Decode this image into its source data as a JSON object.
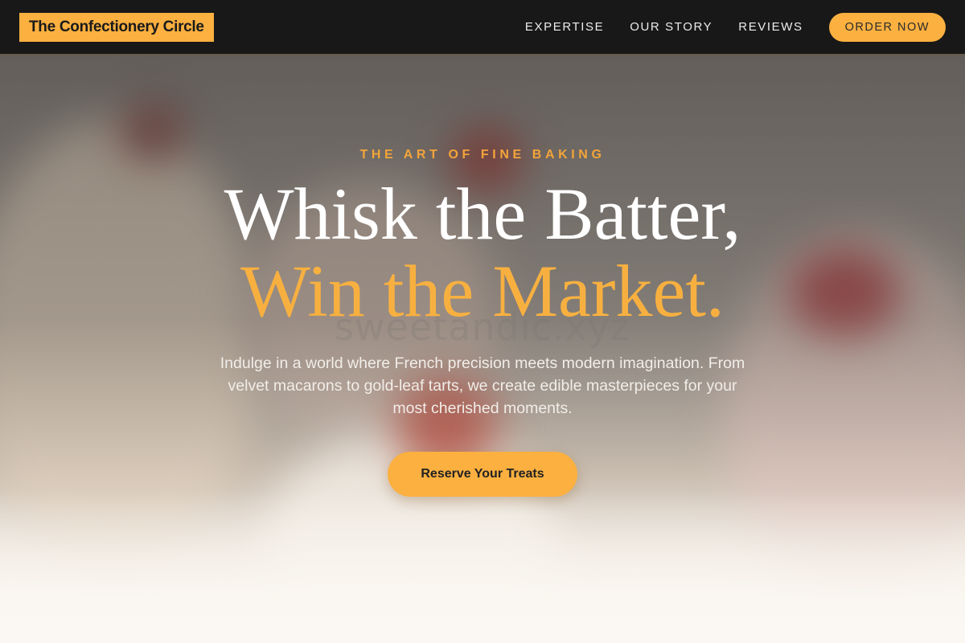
{
  "header": {
    "logo": "The Confectionery Circle",
    "nav": [
      "EXPERTISE",
      "OUR STORY",
      "REVIEWS"
    ],
    "order_button": "ORDER NOW"
  },
  "hero": {
    "eyebrow": "THE ART OF FINE BAKING",
    "headline_line1": "Whisk the Batter,",
    "headline_line2": "Win the Market.",
    "subtext": "Indulge in a world where French precision meets modern imagination. From velvet macarons to gold-leaf tarts, we create edible masterpieces for your most cherished moments.",
    "cta": "Reserve Your Treats",
    "watermark": "sweetandic.xyz"
  },
  "colors": {
    "accent": "#fbb040",
    "header_bg": "#181818",
    "eyebrow": "#f3a43a"
  }
}
